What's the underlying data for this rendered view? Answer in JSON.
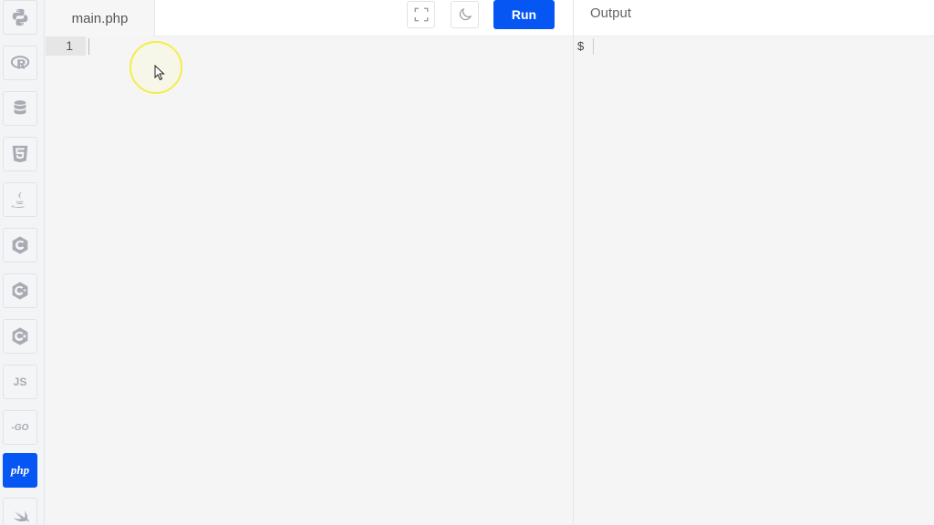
{
  "sidebar": {
    "languages": [
      {
        "name": "python",
        "icon": "python-icon"
      },
      {
        "name": "r",
        "icon": "r-icon"
      },
      {
        "name": "sql",
        "icon": "database-icon"
      },
      {
        "name": "html",
        "icon": "html5-icon"
      },
      {
        "name": "java",
        "icon": "java-icon"
      },
      {
        "name": "c",
        "icon": "c-icon"
      },
      {
        "name": "cpp",
        "icon": "cpp-icon"
      },
      {
        "name": "csharp",
        "icon": "csharp-icon"
      },
      {
        "name": "js",
        "label": "JS",
        "icon": "js-icon"
      },
      {
        "name": "go",
        "label": "-GO",
        "icon": "go-icon"
      },
      {
        "name": "php",
        "label": "php",
        "icon": "php-icon",
        "active": true
      },
      {
        "name": "swift",
        "icon": "swift-icon"
      }
    ]
  },
  "editor": {
    "file_tab": "main.php",
    "line_numbers": [
      "1"
    ],
    "run_label": "Run"
  },
  "output": {
    "title": "Output",
    "prompt": "$"
  },
  "colors": {
    "accent": "#0556f3",
    "cursor_highlight": "#f2ee4a"
  }
}
